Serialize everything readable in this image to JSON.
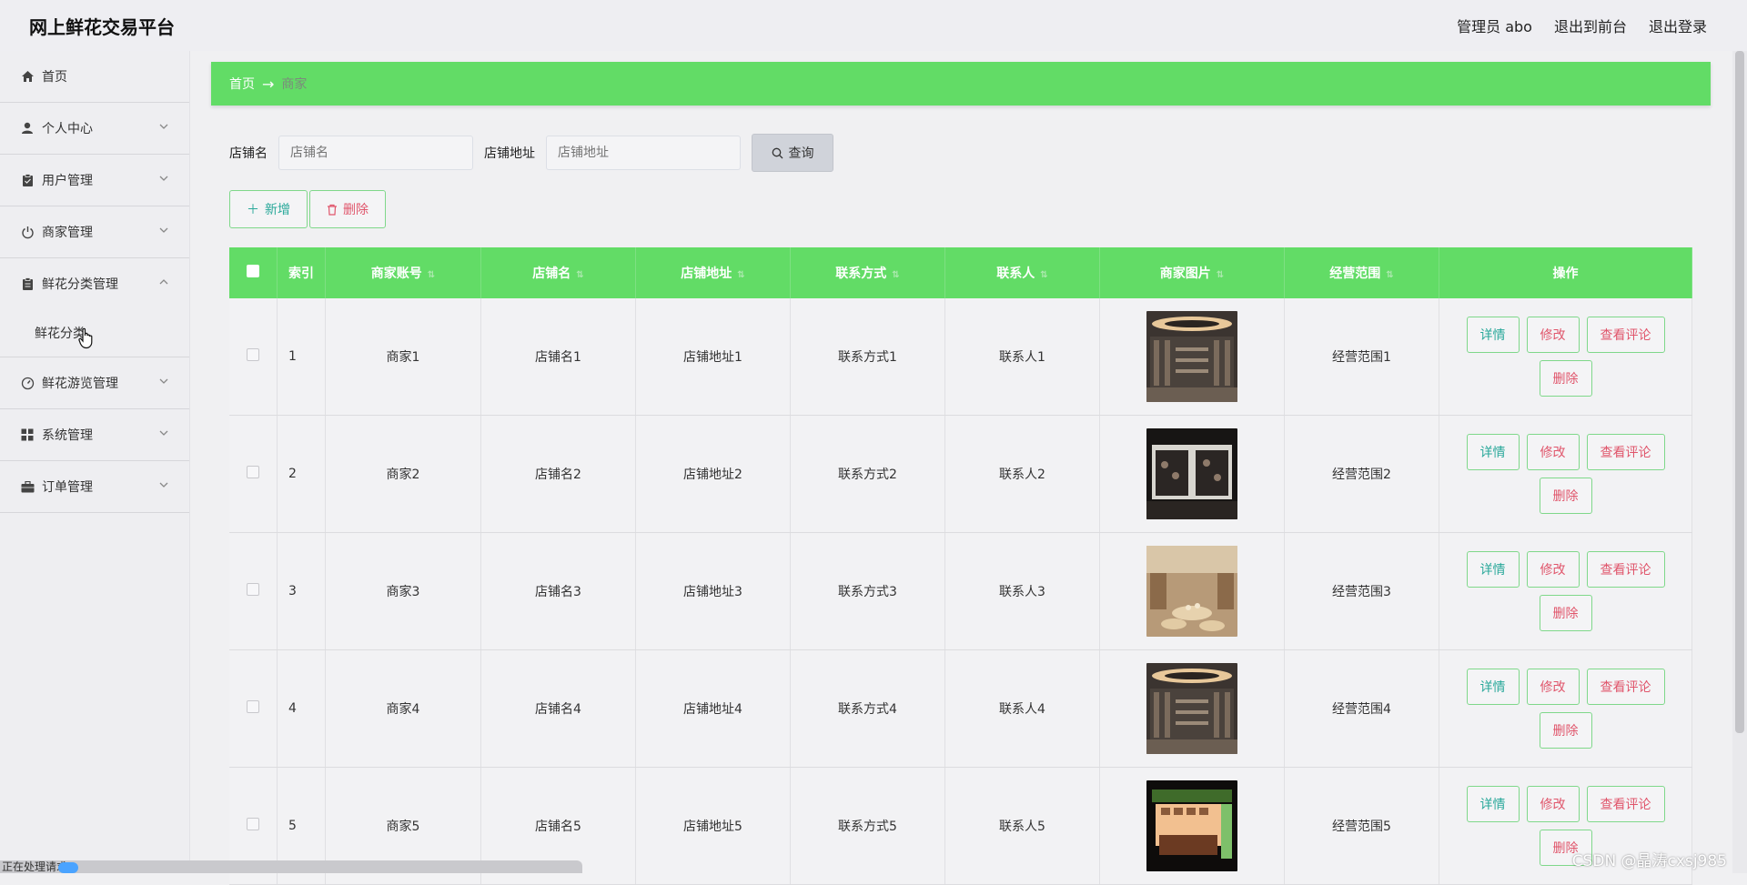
{
  "header": {
    "app_title": "网上鲜花交易平台",
    "admin_label": "管理员 abo",
    "to_front_label": "退出到前台",
    "logout_label": "退出登录"
  },
  "sidebar": {
    "items": [
      {
        "label": "首页",
        "icon": "home-icon",
        "expandable": false
      },
      {
        "label": "个人中心",
        "icon": "user-icon",
        "expandable": true
      },
      {
        "label": "用户管理",
        "icon": "clipboard-icon",
        "expandable": true
      },
      {
        "label": "商家管理",
        "icon": "power-icon",
        "expandable": true
      },
      {
        "label": "鲜花分类管理",
        "icon": "clipboard-icon",
        "expandable": true,
        "expanded": true
      },
      {
        "label": "鲜花分类",
        "submenu": true
      },
      {
        "label": "鲜花游览管理",
        "icon": "gauge-icon",
        "expandable": true
      },
      {
        "label": "系统管理",
        "icon": "grid-icon",
        "expandable": true
      },
      {
        "label": "订单管理",
        "icon": "briefcase-icon",
        "expandable": true
      }
    ]
  },
  "breadcrumb": {
    "home": "首页",
    "arrow": "→",
    "current": "商家"
  },
  "search": {
    "shop_name_label": "店铺名",
    "shop_name_placeholder": "店铺名",
    "shop_address_label": "店铺地址",
    "shop_address_placeholder": "店铺地址",
    "query_label": "查询"
  },
  "actions": {
    "add_label": "新增",
    "delete_label": "删除"
  },
  "table": {
    "columns": [
      "索引",
      "商家账号",
      "店铺名",
      "店铺地址",
      "联系方式",
      "联系人",
      "商家图片",
      "经营范围",
      "操作"
    ],
    "rows": [
      {
        "index": "1",
        "account": "商家1",
        "shop_name": "店铺名1",
        "address": "店铺地址1",
        "contact": "联系方式1",
        "person": "联系人1",
        "scope": "经营范围1",
        "image": "shop-interior-icon"
      },
      {
        "index": "2",
        "account": "商家2",
        "shop_name": "店铺名2",
        "address": "店铺地址2",
        "contact": "联系方式2",
        "person": "联系人2",
        "scope": "经营范围2",
        "image": "shop-front-icon"
      },
      {
        "index": "3",
        "account": "商家3",
        "shop_name": "店铺名3",
        "address": "店铺地址3",
        "contact": "联系方式3",
        "person": "联系人3",
        "scope": "经营范围3",
        "image": "shop-display-icon"
      },
      {
        "index": "4",
        "account": "商家4",
        "shop_name": "店铺名4",
        "address": "店铺地址4",
        "contact": "联系方式4",
        "person": "联系人4",
        "scope": "经营范围4",
        "image": "shop-interior-icon"
      },
      {
        "index": "5",
        "account": "商家5",
        "shop_name": "店铺名5",
        "address": "店铺地址5",
        "contact": "联系方式5",
        "person": "联系人5",
        "scope": "经营范围5",
        "image": "shop-kiosk-icon"
      }
    ],
    "row_actions": {
      "detail": "详情",
      "edit": "修改",
      "review": "查看评论",
      "delete": "删除"
    }
  },
  "status": {
    "loading_text": "正在处理请求"
  },
  "watermark": "CSDN @晶涛cxsj985",
  "colors": {
    "accent_green": "#62dc66",
    "detail_teal": "#29a89a",
    "danger_pink": "#e0556b"
  }
}
